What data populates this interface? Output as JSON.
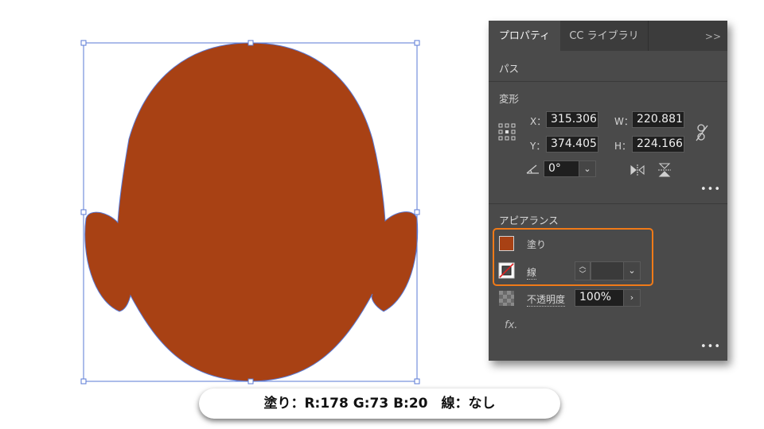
{
  "colors": {
    "fill": "#a84114",
    "selection": "#5a7ad6",
    "highlight": "#f07a18",
    "panel_bg": "#4a4a4a"
  },
  "panel": {
    "tabs": [
      "プロパティ",
      "CC ライブラリ"
    ],
    "collapse_icon": "double-chevron-right-icon",
    "object_type": "パス",
    "transform": {
      "title": "変形",
      "x_label": "X：",
      "x_value": "315.306",
      "y_label": "Y：",
      "y_value": "374.405",
      "w_label": "W：",
      "w_value": "220.881",
      "h_label": "H：",
      "h_value": "224.166",
      "angle_value": "0°",
      "more": "•••"
    },
    "appearance": {
      "title": "アピアランス",
      "fill_label": "塗り",
      "stroke_label": "線",
      "stroke_weight": "",
      "opacity_label": "不透明度",
      "opacity_value": "100%",
      "fx_label": "fx.",
      "more": "•••"
    }
  },
  "caption": "塗り：R:178 G:73 B:20　線：なし"
}
